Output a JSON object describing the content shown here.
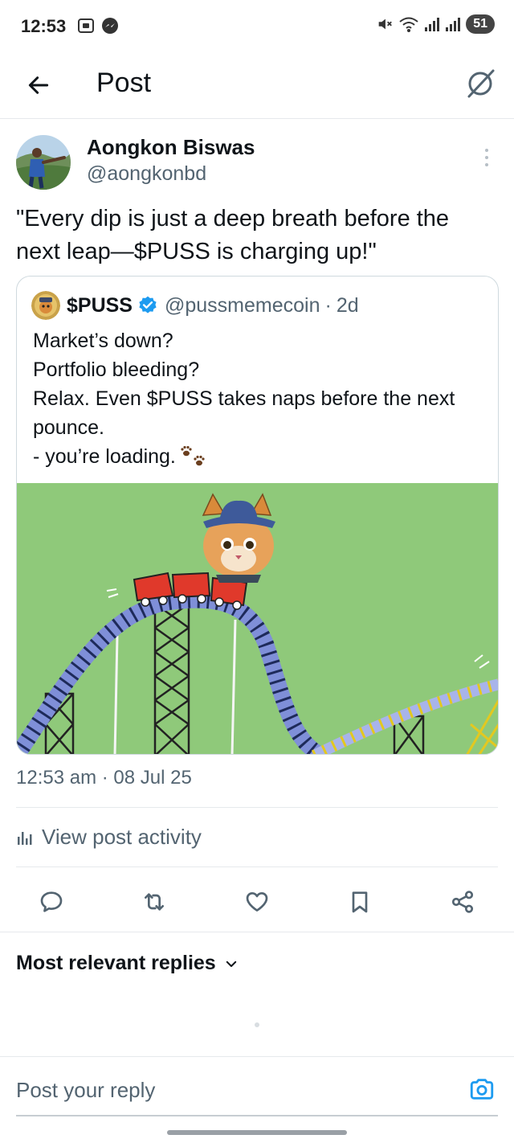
{
  "status_bar": {
    "time": "12:53",
    "battery": "51",
    "left_icons": [
      "screenshot-icon",
      "messenger-icon"
    ],
    "right_icons": [
      "mute-icon",
      "wifi-icon",
      "signal-icon",
      "signal-icon"
    ]
  },
  "header": {
    "title": "Post",
    "back_icon": "arrow-left-icon",
    "grok_icon": "grok-icon"
  },
  "post": {
    "author_name": "Aongkon Biswas",
    "author_handle": "@aongkonbd",
    "text": "\"Every dip is just a deep breath before the next leap—$PUSS is charging up!\"",
    "timestamp": "12:53 am · 08 Jul 25"
  },
  "quote": {
    "name": "$PUSS",
    "handle": "@pussmemecoin",
    "separator": "·",
    "age": "2d",
    "lines": [
      "Market’s down?",
      "Portfolio bleeding?",
      "Relax. Even $PUSS takes naps before the next pounce.",
      "- you’re loading."
    ]
  },
  "activity": {
    "label": "View post activity",
    "icon": "bar-chart-icon"
  },
  "actions": [
    {
      "name": "reply",
      "icon": "reply-icon"
    },
    {
      "name": "repost",
      "icon": "repost-icon"
    },
    {
      "name": "like",
      "icon": "heart-icon"
    },
    {
      "name": "bookmark",
      "icon": "bookmark-icon"
    },
    {
      "name": "share",
      "icon": "share-icon"
    }
  ],
  "replies": {
    "sort_label": "Most relevant replies"
  },
  "reply_bar": {
    "placeholder": "Post your reply"
  },
  "colors": {
    "accent": "#1d9bf0",
    "text": "#0f1419",
    "secondary_text": "#536471",
    "media_background": "#8fc97a"
  }
}
